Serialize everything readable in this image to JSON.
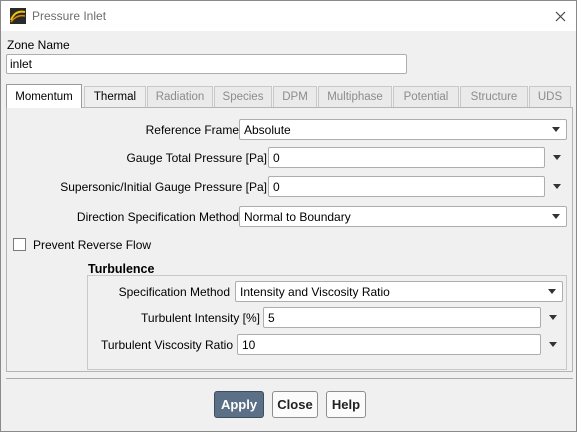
{
  "window": {
    "title": "Pressure Inlet",
    "app_icon": "fluent-app-icon",
    "close_icon": "close-icon"
  },
  "zone": {
    "label": "Zone Name",
    "value": "inlet"
  },
  "tabs": [
    {
      "label": "Momentum",
      "state": "active"
    },
    {
      "label": "Thermal",
      "state": "enabled"
    },
    {
      "label": "Radiation",
      "state": "disabled"
    },
    {
      "label": "Species",
      "state": "disabled"
    },
    {
      "label": "DPM",
      "state": "disabled"
    },
    {
      "label": "Multiphase",
      "state": "disabled"
    },
    {
      "label": "Potential",
      "state": "disabled"
    },
    {
      "label": "Structure",
      "state": "disabled"
    },
    {
      "label": "UDS",
      "state": "disabled"
    }
  ],
  "momentum": {
    "reference_frame": {
      "label": "Reference Frame",
      "value": "Absolute"
    },
    "gauge_total_pressure": {
      "label": "Gauge Total Pressure [Pa]",
      "value": "0"
    },
    "supersonic_pressure": {
      "label": "Supersonic/Initial Gauge Pressure [Pa]",
      "value": "0"
    },
    "direction_method": {
      "label": "Direction Specification Method",
      "value": "Normal to Boundary"
    },
    "prevent_reverse_flow": {
      "label": "Prevent Reverse Flow",
      "checked": false
    }
  },
  "turbulence": {
    "title": "Turbulence",
    "specification_method": {
      "label": "Specification Method",
      "value": "Intensity and Viscosity Ratio"
    },
    "intensity": {
      "label": "Turbulent Intensity [%]",
      "value": "5"
    },
    "viscosity_ratio": {
      "label": "Turbulent Viscosity Ratio",
      "value": "10"
    }
  },
  "buttons": {
    "apply": "Apply",
    "close": "Close",
    "help": "Help"
  },
  "colors": {
    "accent_button": "#5b6f86",
    "background": "#f0f0f0"
  }
}
